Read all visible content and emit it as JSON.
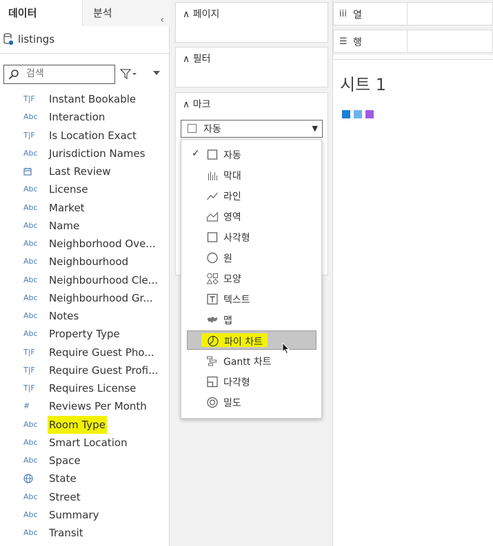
{
  "left_pane": {
    "tab_data": "데이터",
    "tab_analysis": "분석",
    "datasource": "listings",
    "search_placeholder": "검색",
    "fields": [
      {
        "type": "bool",
        "icon": "T|F",
        "label": "Instant Bookable"
      },
      {
        "type": "string",
        "icon": "Abc",
        "label": "Interaction"
      },
      {
        "type": "bool",
        "icon": "T|F",
        "label": "Is Location Exact"
      },
      {
        "type": "string",
        "icon": "Abc",
        "label": "Jurisdiction Names"
      },
      {
        "type": "date",
        "icon": "calendar-icon",
        "label": "Last Review"
      },
      {
        "type": "string",
        "icon": "Abc",
        "label": "License"
      },
      {
        "type": "string",
        "icon": "Abc",
        "label": "Market"
      },
      {
        "type": "string",
        "icon": "Abc",
        "label": "Name"
      },
      {
        "type": "string",
        "icon": "Abc",
        "label": "Neighborhood Ove..."
      },
      {
        "type": "string",
        "icon": "Abc",
        "label": "Neighbourhood"
      },
      {
        "type": "string",
        "icon": "Abc",
        "label": "Neighbourhood Cle..."
      },
      {
        "type": "string",
        "icon": "Abc",
        "label": "Neighbourhood Gr..."
      },
      {
        "type": "string",
        "icon": "Abc",
        "label": "Notes"
      },
      {
        "type": "string",
        "icon": "Abc",
        "label": "Property Type"
      },
      {
        "type": "bool",
        "icon": "T|F",
        "label": "Require Guest Pho..."
      },
      {
        "type": "bool",
        "icon": "T|F",
        "label": "Require Guest Profi..."
      },
      {
        "type": "bool",
        "icon": "T|F",
        "label": "Requires License"
      },
      {
        "type": "number",
        "icon": "#",
        "label": "Reviews Per Month"
      },
      {
        "type": "string",
        "icon": "Abc",
        "label": "Room Type",
        "highlighted": true
      },
      {
        "type": "string",
        "icon": "Abc",
        "label": "Smart Location"
      },
      {
        "type": "string",
        "icon": "Abc",
        "label": "Space"
      },
      {
        "type": "geo",
        "icon": "globe-icon",
        "label": "State"
      },
      {
        "type": "string",
        "icon": "Abc",
        "label": "Street"
      },
      {
        "type": "string",
        "icon": "Abc",
        "label": "Summary"
      },
      {
        "type": "string",
        "icon": "Abc",
        "label": "Transit"
      }
    ]
  },
  "shelves": {
    "pages": "페이지",
    "filters": "필터",
    "marks": "마크",
    "mark_type_selected": "자동"
  },
  "mark_menu": {
    "items": [
      {
        "label": "자동",
        "icon": "square-icon",
        "checked": true
      },
      {
        "label": "막대",
        "icon": "bar-icon"
      },
      {
        "label": "라인",
        "icon": "line-icon"
      },
      {
        "label": "영역",
        "icon": "area-icon"
      },
      {
        "label": "사각형",
        "icon": "square-icon"
      },
      {
        "label": "원",
        "icon": "circle-icon"
      },
      {
        "label": "모양",
        "icon": "shape-icon"
      },
      {
        "label": "텍스트",
        "icon": "text-icon"
      },
      {
        "label": "맵",
        "icon": "map-icon"
      },
      {
        "label": "파이 차트",
        "icon": "pie-icon",
        "selected": true,
        "highlighted": true
      },
      {
        "label": "Gantt 차트",
        "icon": "gantt-icon"
      },
      {
        "label": "다각형",
        "icon": "polygon-icon"
      },
      {
        "label": "밀도",
        "icon": "density-icon"
      }
    ]
  },
  "view": {
    "columns_label": "열",
    "rows_label": "행",
    "sheet_title": "시트 1",
    "legend_colors": [
      "#1a7fd4",
      "#6cb4ee",
      "#a05ae0"
    ]
  },
  "colors": {
    "highlight": "#f2f200",
    "menu_selected": "#c6c6c6"
  }
}
